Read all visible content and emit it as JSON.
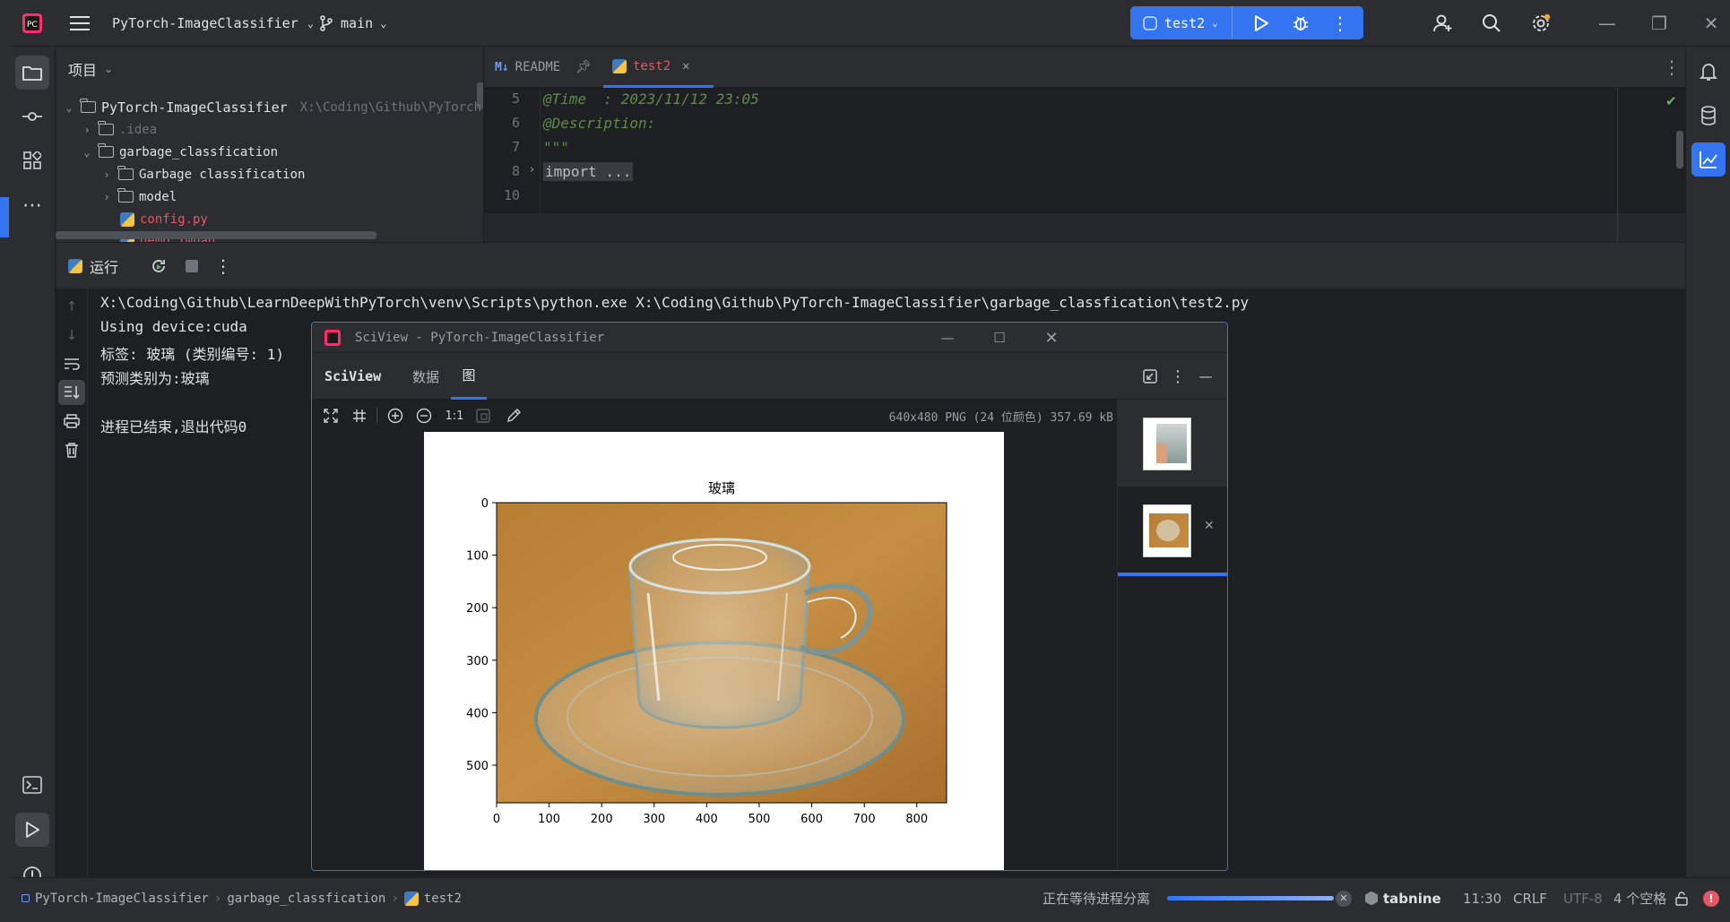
{
  "titlebar": {
    "project_name": "PyTorch-ImageClassifier",
    "branch": "main",
    "run_config": "test2"
  },
  "project_panel": {
    "title": "项目",
    "root_name": "PyTorch-ImageClassifier",
    "root_path": "X:\\Coding\\Github\\PyTorch-I",
    "items": [
      {
        "label": "idea",
        "name_display": ".idea"
      },
      {
        "label": "garbage_classfication"
      },
      {
        "label": "Garbage classification"
      },
      {
        "label": "model"
      },
      {
        "label": "config.py"
      },
      {
        "label": "demo_jwuah"
      }
    ]
  },
  "editor": {
    "tabs": [
      {
        "label": "README",
        "prefix": "M↓"
      },
      {
        "label": "test2"
      }
    ],
    "lines": [
      {
        "num": "5",
        "text": "@Time  : 2023/11/12 23:05"
      },
      {
        "num": "6",
        "text": "@Description:"
      },
      {
        "num": "7",
        "text": "\"\"\""
      },
      {
        "num": "8",
        "text": "import ..."
      },
      {
        "num": "10",
        "text": ""
      }
    ]
  },
  "run_panel": {
    "title": "运行",
    "console": [
      "X:\\Coding\\Github\\LearnDeepWithPyTorch\\venv\\Scripts\\python.exe X:\\Coding\\Github\\PyTorch-ImageClassifier\\garbage_classfication\\test2.py",
      "Using device:cuda",
      "标签: 玻璃 (类别编号: 1)",
      "预测类别为:玻璃",
      "",
      "进程已结束,退出代码0"
    ]
  },
  "sciview": {
    "window_title": "SciView - PyTorch-ImageClassifier",
    "tabs": [
      "SciView",
      "数据",
      "图"
    ],
    "zoom_label": "1:1",
    "image_info": "640x480 PNG (24 位颜色) 357.69 kB",
    "plot": {
      "title": "玻璃",
      "x_ticks": [
        "0",
        "100",
        "200",
        "300",
        "400",
        "500",
        "600",
        "700",
        "800"
      ],
      "y_ticks": [
        "0",
        "100",
        "200",
        "300",
        "400",
        "500"
      ]
    }
  },
  "statusbar": {
    "breadcrumb": [
      "PyTorch-ImageClassifier",
      "garbage_classfication",
      "test2"
    ],
    "process_status": "正在等待进程分离",
    "plugin": "tabnine",
    "position": "11:30",
    "line_ending": "CRLF",
    "encoding": "UTF-8",
    "indent": "4 个空格"
  },
  "colors": {
    "accent": "#3574f0",
    "background": "#1e1f22",
    "panel": "#2b2d30",
    "error": "#e55765"
  }
}
